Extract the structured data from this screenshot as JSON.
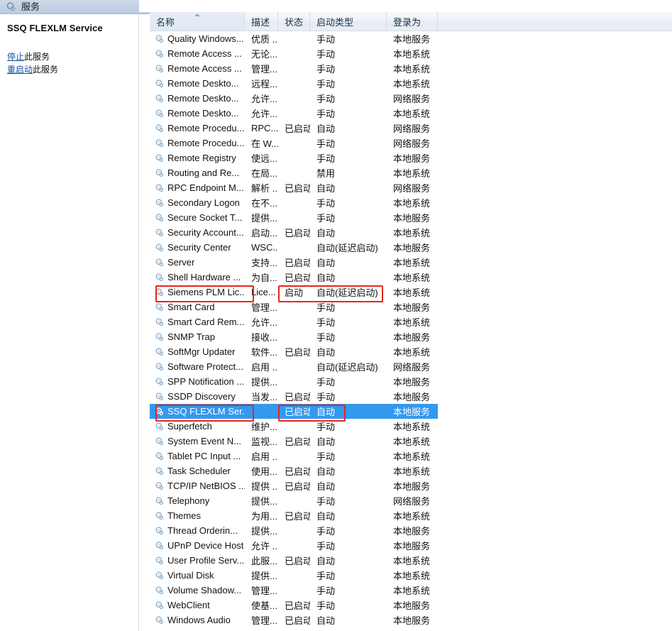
{
  "window": {
    "title": "服务",
    "icon": "services-gear-icon"
  },
  "details_pane": {
    "service_name": "SSQ FLEXLM Service",
    "links": [
      {
        "action": "停止",
        "suffix": "此服务",
        "name": "stop-service-link"
      },
      {
        "action": "重启动",
        "suffix": "此服务",
        "name": "restart-service-link"
      }
    ]
  },
  "colors": {
    "selection_blue": "#3399ee",
    "annotation_red": "#e8251b",
    "link_blue": "#14539f",
    "titlebar": "#c3d2e4"
  },
  "list": {
    "columns": [
      {
        "key": "name",
        "label": "名称",
        "sorted": true
      },
      {
        "key": "desc",
        "label": "描述",
        "sorted": false
      },
      {
        "key": "state",
        "label": "状态",
        "sorted": false
      },
      {
        "key": "start",
        "label": "启动类型",
        "sorted": false
      },
      {
        "key": "logon",
        "label": "登录为",
        "sorted": false
      }
    ],
    "rows": [
      {
        "name": "Quality Windows...",
        "desc": "优质 ...",
        "state": "",
        "start": "手动",
        "logon": "本地服务"
      },
      {
        "name": "Remote Access ...",
        "desc": "无论...",
        "state": "",
        "start": "手动",
        "logon": "本地系统"
      },
      {
        "name": "Remote Access ...",
        "desc": "管理...",
        "state": "",
        "start": "手动",
        "logon": "本地系统"
      },
      {
        "name": "Remote Deskto...",
        "desc": "远程...",
        "state": "",
        "start": "手动",
        "logon": "本地系统"
      },
      {
        "name": "Remote Deskto...",
        "desc": "允许...",
        "state": "",
        "start": "手动",
        "logon": "网络服务"
      },
      {
        "name": "Remote Deskto...",
        "desc": "允许...",
        "state": "",
        "start": "手动",
        "logon": "本地系统"
      },
      {
        "name": "Remote Procedu...",
        "desc": "RPC...",
        "state": "已启动",
        "start": "自动",
        "logon": "网络服务"
      },
      {
        "name": "Remote Procedu...",
        "desc": "在 W...",
        "state": "",
        "start": "手动",
        "logon": "网络服务"
      },
      {
        "name": "Remote Registry",
        "desc": "使远...",
        "state": "",
        "start": "手动",
        "logon": "本地服务"
      },
      {
        "name": "Routing and Re...",
        "desc": "在局...",
        "state": "",
        "start": "禁用",
        "logon": "本地系统"
      },
      {
        "name": "RPC Endpoint M...",
        "desc": "解析 ...",
        "state": "已启动",
        "start": "自动",
        "logon": "网络服务"
      },
      {
        "name": "Secondary Logon",
        "desc": "在不...",
        "state": "",
        "start": "手动",
        "logon": "本地系统"
      },
      {
        "name": "Secure Socket T...",
        "desc": "提供...",
        "state": "",
        "start": "手动",
        "logon": "本地服务"
      },
      {
        "name": "Security Account...",
        "desc": "启动...",
        "state": "已启动",
        "start": "自动",
        "logon": "本地系统"
      },
      {
        "name": "Security Center",
        "desc": "WSC...",
        "state": "",
        "start": "自动(延迟启动)",
        "logon": "本地服务"
      },
      {
        "name": "Server",
        "desc": "支持...",
        "state": "已启动",
        "start": "自动",
        "logon": "本地系统"
      },
      {
        "name": "Shell Hardware ...",
        "desc": "为自...",
        "state": "已启动",
        "start": "自动",
        "logon": "本地系统"
      },
      {
        "name": "Siemens PLM Lic...",
        "desc": "Lice...",
        "state": "启动",
        "start": "自动(延迟启动)",
        "logon": "本地系统"
      },
      {
        "name": "Smart Card",
        "desc": "管理...",
        "state": "",
        "start": "手动",
        "logon": "本地服务"
      },
      {
        "name": "Smart Card Rem...",
        "desc": "允许...",
        "state": "",
        "start": "手动",
        "logon": "本地系统"
      },
      {
        "name": "SNMP Trap",
        "desc": "接收...",
        "state": "",
        "start": "手动",
        "logon": "本地服务"
      },
      {
        "name": "SoftMgr Updater",
        "desc": "软件...",
        "state": "已启动",
        "start": "自动",
        "logon": "本地系统"
      },
      {
        "name": "Software Protect...",
        "desc": "启用 ...",
        "state": "",
        "start": "自动(延迟启动)",
        "logon": "网络服务"
      },
      {
        "name": "SPP Notification ...",
        "desc": "提供...",
        "state": "",
        "start": "手动",
        "logon": "本地服务"
      },
      {
        "name": "SSDP Discovery",
        "desc": "当发...",
        "state": "已启动",
        "start": "手动",
        "logon": "本地服务"
      },
      {
        "name": "SSQ FLEXLM Ser...",
        "desc": "",
        "state": "已启动",
        "start": "自动",
        "logon": "本地服务",
        "selected": true
      },
      {
        "name": "Superfetch",
        "desc": "维护...",
        "state": "",
        "start": "手动",
        "logon": "本地系统"
      },
      {
        "name": "System Event N...",
        "desc": "监视...",
        "state": "已启动",
        "start": "自动",
        "logon": "本地系统"
      },
      {
        "name": "Tablet PC Input ...",
        "desc": "启用 ...",
        "state": "",
        "start": "手动",
        "logon": "本地系统"
      },
      {
        "name": "Task Scheduler",
        "desc": "使用...",
        "state": "已启动",
        "start": "自动",
        "logon": "本地系统"
      },
      {
        "name": "TCP/IP NetBIOS ...",
        "desc": "提供 ...",
        "state": "已启动",
        "start": "自动",
        "logon": "本地服务"
      },
      {
        "name": "Telephony",
        "desc": "提供...",
        "state": "",
        "start": "手动",
        "logon": "网络服务"
      },
      {
        "name": "Themes",
        "desc": "为用...",
        "state": "已启动",
        "start": "自动",
        "logon": "本地系统"
      },
      {
        "name": "Thread Orderin...",
        "desc": "提供...",
        "state": "",
        "start": "手动",
        "logon": "本地服务"
      },
      {
        "name": "UPnP Device Host",
        "desc": "允许 ...",
        "state": "",
        "start": "手动",
        "logon": "本地服务"
      },
      {
        "name": "User Profile Serv...",
        "desc": "此服...",
        "state": "已启动",
        "start": "自动",
        "logon": "本地系统"
      },
      {
        "name": "Virtual Disk",
        "desc": "提供...",
        "state": "",
        "start": "手动",
        "logon": "本地系统"
      },
      {
        "name": "Volume Shadow...",
        "desc": "管理...",
        "state": "",
        "start": "手动",
        "logon": "本地系统"
      },
      {
        "name": "WebClient",
        "desc": "使基...",
        "state": "已启动",
        "start": "手动",
        "logon": "本地服务"
      },
      {
        "name": "Windows Audio",
        "desc": "管理...",
        "state": "已启动",
        "start": "自动",
        "logon": "本地服务"
      }
    ]
  },
  "annotations": [
    {
      "id": "an-siemens-name",
      "name": "annotation-box-siemens-name"
    },
    {
      "id": "an-siemens-state",
      "name": "annotation-box-siemens-status"
    },
    {
      "id": "an-ssq-name",
      "name": "annotation-box-ssq-name"
    },
    {
      "id": "an-ssq-state",
      "name": "annotation-box-ssq-status"
    }
  ]
}
